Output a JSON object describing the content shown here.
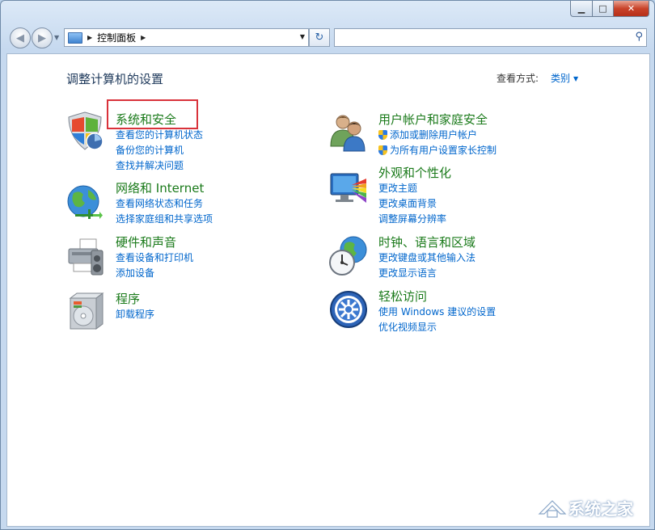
{
  "address": {
    "crumb": "控制面板"
  },
  "search": {
    "placeholder": ""
  },
  "header": {
    "title": "调整计算机的设置",
    "view_by_label": "查看方式:",
    "view_by_value": "类别"
  },
  "categories": {
    "system": {
      "title": "系统和安全",
      "links": [
        "查看您的计算机状态",
        "备份您的计算机",
        "查找并解决问题"
      ]
    },
    "network": {
      "title": "网络和 Internet",
      "links": [
        "查看网络状态和任务",
        "选择家庭组和共享选项"
      ]
    },
    "hardware": {
      "title": "硬件和声音",
      "links": [
        "查看设备和打印机",
        "添加设备"
      ]
    },
    "programs": {
      "title": "程序",
      "links": [
        "卸载程序"
      ]
    },
    "users": {
      "title": "用户帐户和家庭安全",
      "links": [
        "添加或删除用户帐户",
        "为所有用户设置家长控制"
      ]
    },
    "appearance": {
      "title": "外观和个性化",
      "links": [
        "更改主题",
        "更改桌面背景",
        "调整屏幕分辨率"
      ]
    },
    "clock": {
      "title": "时钟、语言和区域",
      "links": [
        "更改键盘或其他输入法",
        "更改显示语言"
      ]
    },
    "ease": {
      "title": "轻松访问",
      "links": [
        "使用 Windows 建议的设置",
        "优化视频显示"
      ]
    }
  },
  "watermark": {
    "text": "系统之家"
  },
  "colors": {
    "category_title": "#1a7a1a",
    "link": "#0066cc",
    "highlight_box": "#d9323a"
  }
}
